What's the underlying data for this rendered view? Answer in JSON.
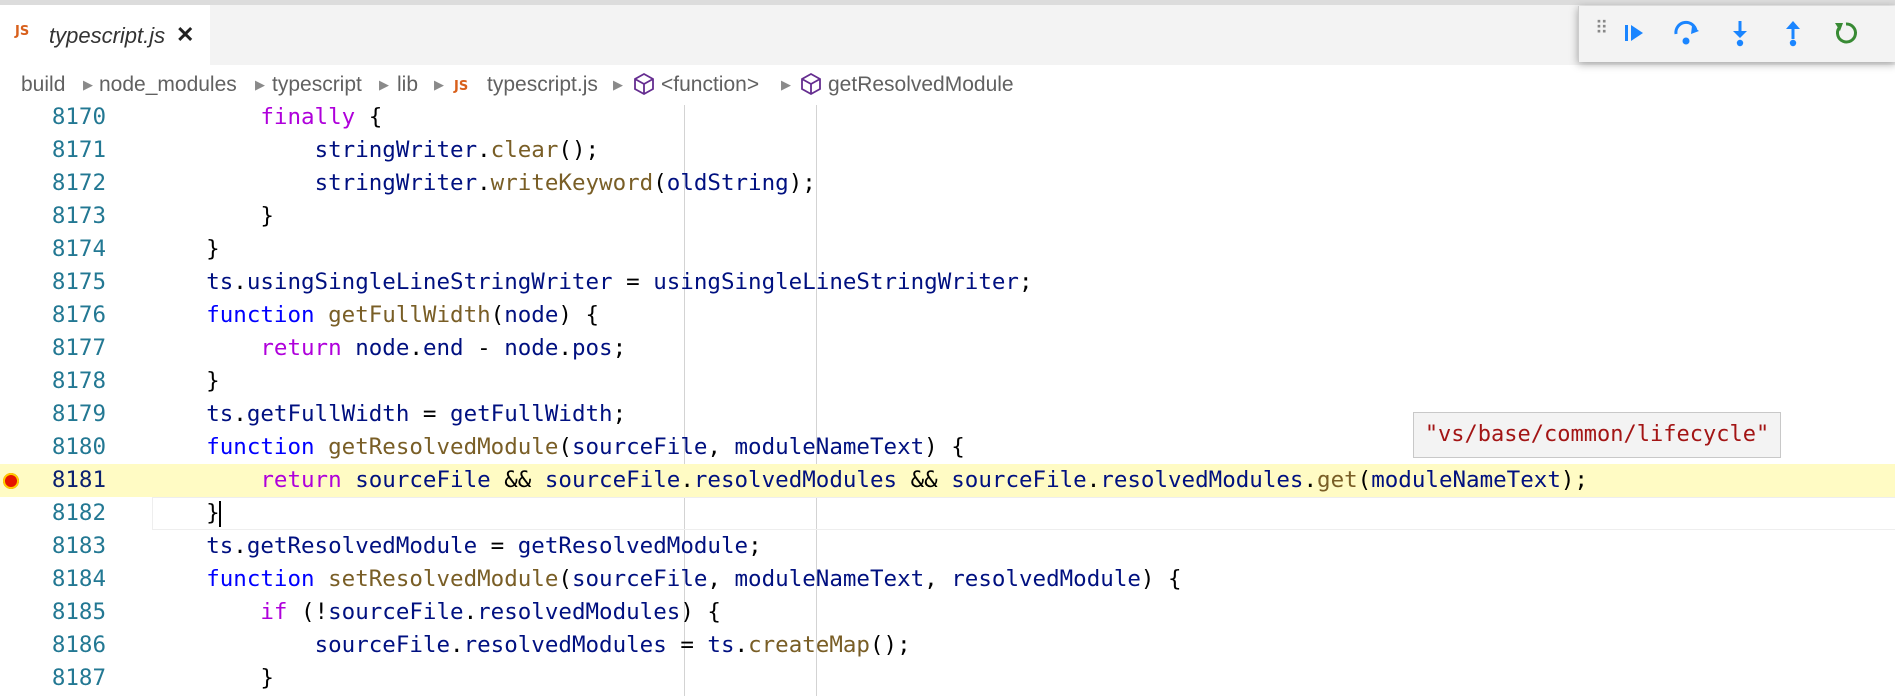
{
  "tab": {
    "icon": "JS",
    "title": "typescript.js",
    "close": "✕"
  },
  "breadcrumb": {
    "items": [
      "build",
      "node_modules",
      "typescript",
      "lib",
      "typescript.js",
      "<function>",
      "getResolvedModule"
    ],
    "file_icon": "JS"
  },
  "debug_toolbar": {
    "buttons": [
      "continue",
      "step-over",
      "step-into",
      "step-out",
      "restart"
    ]
  },
  "editor": {
    "lines": [
      {
        "n": "8170",
        "tokens": [
          [
            "        ",
            ""
          ],
          [
            "finally",
            "kw"
          ],
          [
            " {",
            ""
          ]
        ]
      },
      {
        "n": "8171",
        "tokens": [
          [
            "            ",
            ""
          ],
          [
            "stringWriter",
            "id"
          ],
          [
            ".",
            ""
          ],
          [
            "clear",
            "fn"
          ],
          [
            "();",
            ""
          ]
        ]
      },
      {
        "n": "8172",
        "tokens": [
          [
            "            ",
            ""
          ],
          [
            "stringWriter",
            "id"
          ],
          [
            ".",
            ""
          ],
          [
            "writeKeyword",
            "fn"
          ],
          [
            "(",
            ""
          ],
          [
            "oldString",
            "id"
          ],
          [
            ");",
            ""
          ]
        ]
      },
      {
        "n": "8173",
        "tokens": [
          [
            "        }",
            ""
          ]
        ]
      },
      {
        "n": "8174",
        "tokens": [
          [
            "    }",
            ""
          ]
        ]
      },
      {
        "n": "8175",
        "tokens": [
          [
            "    ",
            ""
          ],
          [
            "ts",
            "id"
          ],
          [
            ".",
            ""
          ],
          [
            "usingSingleLineStringWriter",
            "id"
          ],
          [
            " = ",
            ""
          ],
          [
            "usingSingleLineStringWriter",
            "id"
          ],
          [
            ";",
            ""
          ]
        ]
      },
      {
        "n": "8176",
        "tokens": [
          [
            "    ",
            ""
          ],
          [
            "function",
            "kb"
          ],
          [
            " ",
            ""
          ],
          [
            "getFullWidth",
            "fn"
          ],
          [
            "(",
            ""
          ],
          [
            "node",
            "id"
          ],
          [
            ") {",
            ""
          ]
        ]
      },
      {
        "n": "8177",
        "tokens": [
          [
            "        ",
            ""
          ],
          [
            "return",
            "kw"
          ],
          [
            " ",
            ""
          ],
          [
            "node",
            "id"
          ],
          [
            ".",
            ""
          ],
          [
            "end",
            "id"
          ],
          [
            " - ",
            ""
          ],
          [
            "node",
            "id"
          ],
          [
            ".",
            ""
          ],
          [
            "pos",
            "id"
          ],
          [
            ";",
            ""
          ]
        ]
      },
      {
        "n": "8178",
        "tokens": [
          [
            "    }",
            ""
          ]
        ]
      },
      {
        "n": "8179",
        "tokens": [
          [
            "    ",
            ""
          ],
          [
            "ts",
            "id"
          ],
          [
            ".",
            ""
          ],
          [
            "getFullWidth",
            "id"
          ],
          [
            " = ",
            ""
          ],
          [
            "getFullWidth",
            "id"
          ],
          [
            ";",
            ""
          ]
        ]
      },
      {
        "n": "8180",
        "tokens": [
          [
            "    ",
            ""
          ],
          [
            "function",
            "kb"
          ],
          [
            " ",
            ""
          ],
          [
            "getResolvedModule",
            "fn"
          ],
          [
            "(",
            ""
          ],
          [
            "sourceFile",
            "id"
          ],
          [
            ", ",
            ""
          ],
          [
            "moduleNameText",
            "id"
          ],
          [
            ") {",
            ""
          ]
        ]
      },
      {
        "n": "8181",
        "tokens": [
          [
            "        ",
            ""
          ],
          [
            "return",
            "kw"
          ],
          [
            " ",
            ""
          ],
          [
            "sourceFile",
            "id"
          ],
          [
            " && ",
            ""
          ],
          [
            "sourceFile",
            "id"
          ],
          [
            ".",
            ""
          ],
          [
            "resolvedModules",
            "id"
          ],
          [
            " && ",
            ""
          ],
          [
            "sourceFile",
            "id"
          ],
          [
            ".",
            ""
          ],
          [
            "resolvedModules",
            "id"
          ],
          [
            ".",
            ""
          ],
          [
            "get",
            "fn"
          ],
          [
            "(",
            ""
          ],
          [
            "moduleNameText",
            "id"
          ],
          [
            ");",
            ""
          ]
        ]
      },
      {
        "n": "8182",
        "tokens": [
          [
            "    }",
            ""
          ]
        ]
      },
      {
        "n": "8183",
        "tokens": [
          [
            "    ",
            ""
          ],
          [
            "ts",
            "id"
          ],
          [
            ".",
            ""
          ],
          [
            "getResolvedModule",
            "id"
          ],
          [
            " = ",
            ""
          ],
          [
            "getResolvedModule",
            "id"
          ],
          [
            ";",
            ""
          ]
        ]
      },
      {
        "n": "8184",
        "tokens": [
          [
            "    ",
            ""
          ],
          [
            "function",
            "kb"
          ],
          [
            " ",
            ""
          ],
          [
            "setResolvedModule",
            "fn"
          ],
          [
            "(",
            ""
          ],
          [
            "sourceFile",
            "id"
          ],
          [
            ", ",
            ""
          ],
          [
            "moduleNameText",
            "id"
          ],
          [
            ", ",
            ""
          ],
          [
            "resolvedModule",
            "id"
          ],
          [
            ") {",
            ""
          ]
        ]
      },
      {
        "n": "8185",
        "tokens": [
          [
            "        ",
            ""
          ],
          [
            "if",
            "kw"
          ],
          [
            " (!",
            ""
          ],
          [
            "sourceFile",
            "id"
          ],
          [
            ".",
            ""
          ],
          [
            "resolvedModules",
            "id"
          ],
          [
            ") {",
            ""
          ]
        ]
      },
      {
        "n": "8186",
        "tokens": [
          [
            "            ",
            ""
          ],
          [
            "sourceFile",
            "id"
          ],
          [
            ".",
            ""
          ],
          [
            "resolvedModules",
            "id"
          ],
          [
            " = ",
            ""
          ],
          [
            "ts",
            "id"
          ],
          [
            ".",
            ""
          ],
          [
            "createMap",
            "fn"
          ],
          [
            "();",
            ""
          ]
        ]
      },
      {
        "n": "8187",
        "tokens": [
          [
            "        }",
            ""
          ]
        ]
      }
    ],
    "current_line": "8181",
    "breakpoint_line": "8181",
    "cursor_line": "8182"
  },
  "hover": {
    "value": "\"vs/base/common/lifecycle\""
  },
  "colors": {
    "keyword": "#af00db",
    "function": "#795e26",
    "identifier": "#001080",
    "control": "#0000ff",
    "accent": "#1a85ff",
    "restart": "#388a34"
  }
}
